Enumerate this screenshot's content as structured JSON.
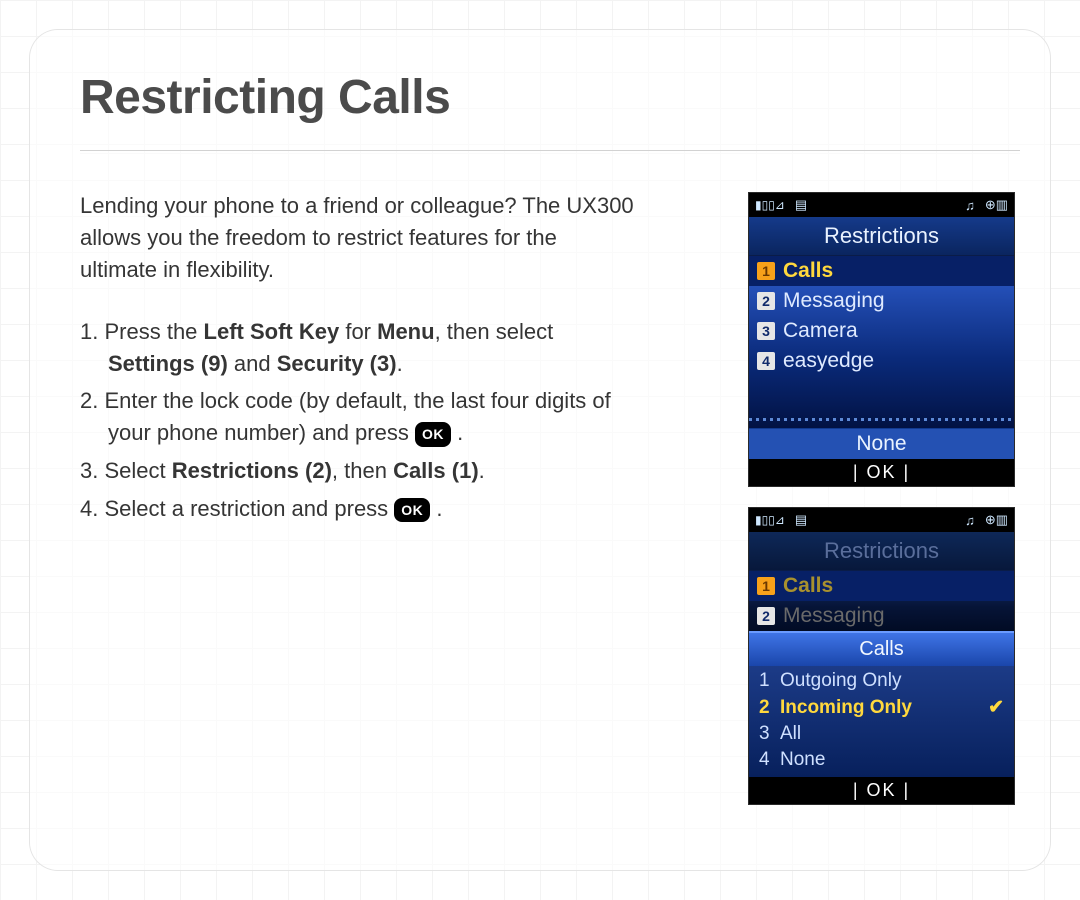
{
  "title": "Restricting Calls",
  "intro": "Lending your phone to a friend or colleague? The UX300 allows you the freedom to restrict features for the ultimate in flexibility.",
  "steps": {
    "s1_a": "Press the ",
    "s1_b": "Left Soft Key",
    "s1_c": " for ",
    "s1_d": "Menu",
    "s1_e": ", then select ",
    "s1_f": "Settings (9)",
    "s1_g": " and ",
    "s1_h": "Security (3)",
    "s1_i": ".",
    "s2_a": "Enter the lock code (by default, the last four digits of your phone number) and press ",
    "s2_ok": "OK",
    "s2_b": " .",
    "s3_a": "Select ",
    "s3_b": "Restrictions (2)",
    "s3_c": ", then ",
    "s3_d": "Calls (1)",
    "s3_e": ".",
    "s4_a": "Select a restriction and press ",
    "s4_ok": "OK",
    "s4_b": " ."
  },
  "phone1": {
    "title": "Restrictions",
    "items": [
      {
        "n": "1",
        "label": "Calls"
      },
      {
        "n": "2",
        "label": "Messaging"
      },
      {
        "n": "3",
        "label": "Camera"
      },
      {
        "n": "4",
        "label": "easyedge"
      }
    ],
    "soft": "None",
    "ok": "| OK |"
  },
  "phone2": {
    "title": "Restrictions",
    "bg_items": [
      {
        "n": "1",
        "label": "Calls"
      },
      {
        "n": "2",
        "label": "Messaging"
      }
    ],
    "popup_title": "Calls",
    "popup_items": [
      {
        "n": "1",
        "label": "Outgoing Only",
        "sel": false
      },
      {
        "n": "2",
        "label": "Incoming Only",
        "sel": true
      },
      {
        "n": "3",
        "label": "All",
        "sel": false
      },
      {
        "n": "4",
        "label": "None",
        "sel": false
      }
    ],
    "ok": "| OK |"
  }
}
